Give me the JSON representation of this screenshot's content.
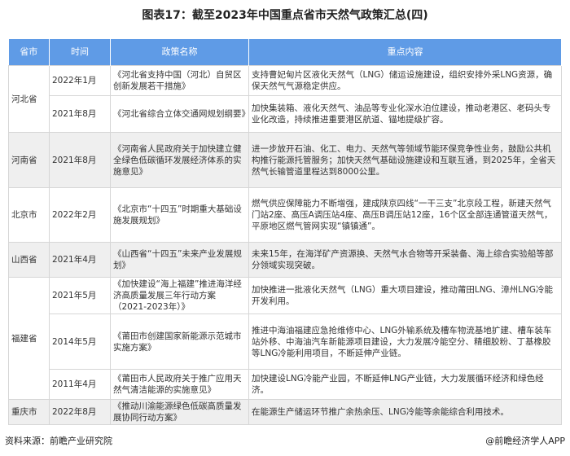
{
  "title": "图表17：截至2023年中国重点省市天然气政策汇总(四)",
  "headers": [
    "省市",
    "时间",
    "政策名称",
    "重点内容"
  ],
  "rows": [
    {
      "province": "河北省",
      "span": 2,
      "time": "2022年1月",
      "policy": "《河北省支持中国（河北）自贸区创新发展若干措施》",
      "content": "支持曹妃甸片区液化天然气（LNG）储运设施建设，组织安排外采LNG资源，确保天然气气源稳定供应。",
      "h": 37
    },
    {
      "time": "2021年8月",
      "policy": "《河北省综合立体交通网规划纲要》",
      "content": "加快集装箱、液化天然气、油品等专业化深水泊位建设，推动老港区、老码头专业化改造，持续推进重要港区航道、锚地提级扩容。",
      "h": 45
    },
    {
      "province": "河南省",
      "span": 1,
      "time": "2021年8月",
      "policy": "《河南省人民政府关于加快建立健全绿色低碳循环发展经济体系的实施意见》",
      "content": "进一步放开石油、化工、电力、天然气等领域节能环保竞争性业务，鼓励公共机构推行能源托管服务；加快天然气基础设施建设和互联互通，到2025年，全省天然气长输管道里程达到8000公里。",
      "h": 68,
      "g": true
    },
    {
      "province": "北京市",
      "span": 1,
      "time": "2022年2月",
      "policy": "《北京市“十四五”时期重大基础设施发展规划》",
      "content": "燃气供应保障能力不断增强，建成陕京四线“一干三支”北京段工程，新建天然气门站2座、高压A调压站4座、高压B调压站12座，16个区全部连通管道天然气，平原地区燃气管网实现“镇镇通”。",
      "h": 67
    },
    {
      "province": "山西省",
      "span": 1,
      "time": "2021年4月",
      "policy": "《山西省“十四五”未来产业发展规划》",
      "content": "未来15年，在海洋矿产资源换、天然气水合物等开采装备、海上综合实验船等部分领域实现突破。",
      "h": 43,
      "g": true
    },
    {
      "province": "福建省",
      "span": 3,
      "time": "2021年5月",
      "policy": "《加快建设“海上福建”推进海洋经济高质量发展三年行动方案（2021-2023年）》",
      "content": "加快推进一批液化天然气（LNG）重大项目建设，推动莆田LNG、漳州LNG冷能开发利用。",
      "h": 44
    },
    {
      "time": "2014年5月",
      "policy": "《莆田市创建国家新能源示范城市实施方案》",
      "content": "推进中海油福建应急抢维修中心、LNG外输系统及槽车物流基地扩建、槽车装车站外移、中海油汽车新能源项目建设，大力发展冷能空分、精细胶粉、丁基橡胶等LNG冷能利用项目，不断延伸产业链。",
      "h": 68
    },
    {
      "time": "2011年4月",
      "policy": "《莆田市人民政府关于推广应用天然气清洁能源的实施意见》",
      "content": "加快建设LNG冷能产业园，不断延伸LNG产业链，大力发展循环经济和绿色经济。",
      "h": 37
    },
    {
      "province": "重庆市",
      "span": 1,
      "time": "2022年8月",
      "policy": "《推动川渝能源绿色低碳高质量发展协同行动方案》",
      "content": "在能源生产储运环节推广余热余压、LNG冷能等余能综合利用技术。",
      "h": 31,
      "g": true
    }
  ],
  "footer": {
    "source": "资料来源：前瞻产业研究院",
    "brand": "@前瞻经济学人APP"
  },
  "colors": {
    "header": "#5f9be6",
    "alt_row": "#efefef"
  }
}
